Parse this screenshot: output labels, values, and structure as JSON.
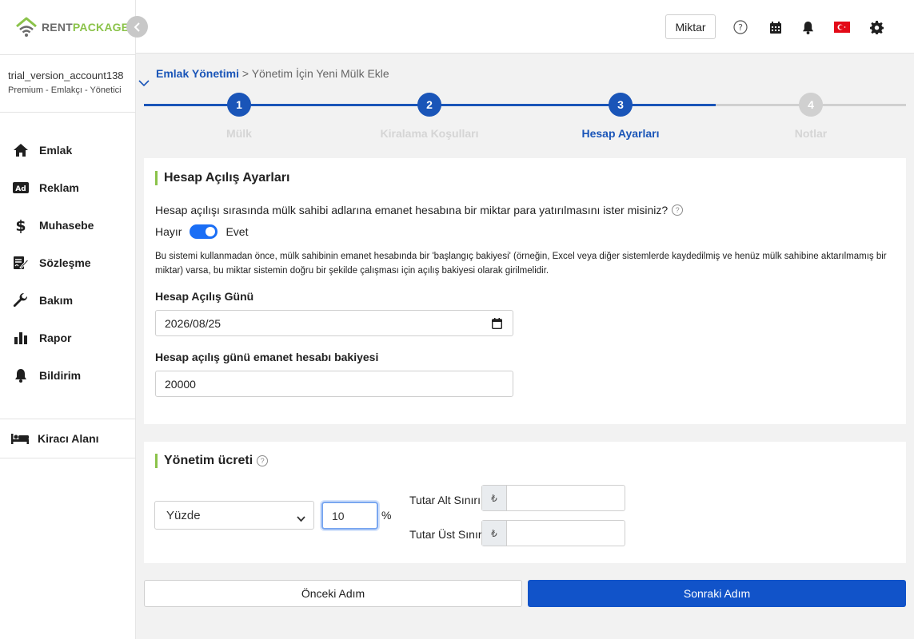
{
  "brand": {
    "rent": "RENT",
    "package": "PACKAGE"
  },
  "account": {
    "name": "trial_version_account138",
    "role": "Premium - Emlakçı - Yönetici"
  },
  "sidebar": {
    "items": [
      {
        "label": "Emlak",
        "icon": "home-icon"
      },
      {
        "label": "Reklam",
        "icon": "ad-icon"
      },
      {
        "label": "Muhasebe",
        "icon": "dollar-icon"
      },
      {
        "label": "Sözleşme",
        "icon": "contract-icon"
      },
      {
        "label": "Bakım",
        "icon": "wrench-icon"
      },
      {
        "label": "Rapor",
        "icon": "bar-chart-icon"
      },
      {
        "label": "Bildirim",
        "icon": "bell-icon"
      }
    ],
    "tenant_label": "Kiracı Alanı"
  },
  "topbar": {
    "amount_button": "Miktar",
    "flag": "turkey-flag-icon"
  },
  "breadcrumb": {
    "link": "Emlak Yönetimi",
    "separator": " > ",
    "current": "Yönetim İçin Yeni Mülk Ekle"
  },
  "steps": [
    {
      "number": "1",
      "label": "Mülk",
      "state": "done"
    },
    {
      "number": "2",
      "label": "Kiralama Koşulları",
      "state": "done"
    },
    {
      "number": "3",
      "label": "Hesap Ayarları",
      "state": "active"
    },
    {
      "number": "4",
      "label": "Notlar",
      "state": "todo"
    }
  ],
  "opening": {
    "title": "Hesap Açılış Ayarları",
    "question": "Hesap açılışı sırasında mülk sahibi adlarına emanet hesabına bir miktar para yatırılmasını ister misiniz?",
    "toggle_no": "Hayır",
    "toggle_yes": "Evet",
    "toggle_on": true,
    "info": "Bu sistemi kullanmadan önce, mülk sahibinin emanet hesabında bir 'başlangıç bakiyesi' (örneğin, Excel veya diğer sistemlerde kaydedilmiş ve henüz mülk sahibine aktarılmamış bir miktar) varsa, bu miktar sistemin doğru bir şekilde çalışması için açılış bakiyesi olarak girilmelidir.",
    "date_label": "Hesap Açılış Günü",
    "date_value": "2026/08/25",
    "balance_label": "Hesap açılış günü emanet hesabı bakiyesi",
    "balance_value": "20000"
  },
  "fee": {
    "title": "Yönetim ücreti",
    "type_selected": "Yüzde",
    "percent_value": "10",
    "percent_symbol": "%",
    "min_label": "Tutar Alt Sınırı",
    "max_label": "Tutar Üst Sınırı",
    "currency": "₺",
    "min_value": "",
    "max_value": ""
  },
  "buttons": {
    "prev": "Önceki Adım",
    "next": "Sonraki Adım"
  },
  "colors": {
    "primary": "#1153c9",
    "step_done": "#1a55b8",
    "step_todo": "#d0d0d0",
    "accent_green": "#8bc34a",
    "toggle": "#1a6ef5"
  }
}
